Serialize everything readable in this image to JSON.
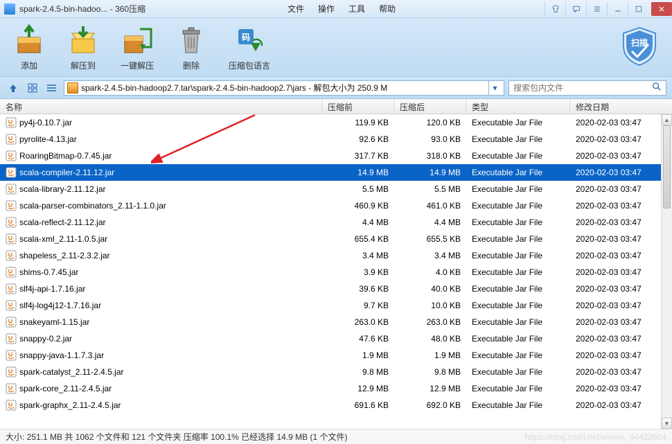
{
  "title": "spark-2.4.5-bin-hadoo... - 360压缩",
  "menu": {
    "file": "文件",
    "operate": "操作",
    "tool": "工具",
    "help": "帮助"
  },
  "ribbon": {
    "add": "添加",
    "extract": "解压到",
    "onekey": "一键解压",
    "delete": "删除",
    "lang": "压缩包语言",
    "scan": "扫描"
  },
  "path": "spark-2.4.5-bin-hadoop2.7.tar\\spark-2.4.5-bin-hadoop2.7\\jars - 解包大小为 250.9 M",
  "search_placeholder": "搜索包内文件",
  "columns": {
    "name": "名称",
    "before": "压缩前",
    "after": "压缩后",
    "type": "类型",
    "date": "修改日期"
  },
  "file_type": "Executable Jar File",
  "file_date": "2020-02-03 03:47",
  "files": [
    {
      "name": "py4j-0.10.7.jar",
      "before": "119.9 KB",
      "after": "120.0 KB",
      "sel": false
    },
    {
      "name": "pyrolite-4.13.jar",
      "before": "92.6 KB",
      "after": "93.0 KB",
      "sel": false
    },
    {
      "name": "RoaringBitmap-0.7.45.jar",
      "before": "317.7 KB",
      "after": "318.0 KB",
      "sel": false
    },
    {
      "name": "scala-compiler-2.11.12.jar",
      "before": "14.9 MB",
      "after": "14.9 MB",
      "sel": true
    },
    {
      "name": "scala-library-2.11.12.jar",
      "before": "5.5 MB",
      "after": "5.5 MB",
      "sel": false
    },
    {
      "name": "scala-parser-combinators_2.11-1.1.0.jar",
      "before": "460.9 KB",
      "after": "461.0 KB",
      "sel": false
    },
    {
      "name": "scala-reflect-2.11.12.jar",
      "before": "4.4 MB",
      "after": "4.4 MB",
      "sel": false
    },
    {
      "name": "scala-xml_2.11-1.0.5.jar",
      "before": "655.4 KB",
      "after": "655.5 KB",
      "sel": false
    },
    {
      "name": "shapeless_2.11-2.3.2.jar",
      "before": "3.4 MB",
      "after": "3.4 MB",
      "sel": false
    },
    {
      "name": "shims-0.7.45.jar",
      "before": "3.9 KB",
      "after": "4.0 KB",
      "sel": false
    },
    {
      "name": "slf4j-api-1.7.16.jar",
      "before": "39.6 KB",
      "after": "40.0 KB",
      "sel": false
    },
    {
      "name": "slf4j-log4j12-1.7.16.jar",
      "before": "9.7 KB",
      "after": "10.0 KB",
      "sel": false
    },
    {
      "name": "snakeyaml-1.15.jar",
      "before": "263.0 KB",
      "after": "263.0 KB",
      "sel": false
    },
    {
      "name": "snappy-0.2.jar",
      "before": "47.6 KB",
      "after": "48.0 KB",
      "sel": false
    },
    {
      "name": "snappy-java-1.1.7.3.jar",
      "before": "1.9 MB",
      "after": "1.9 MB",
      "sel": false
    },
    {
      "name": "spark-catalyst_2.11-2.4.5.jar",
      "before": "9.8 MB",
      "after": "9.8 MB",
      "sel": false
    },
    {
      "name": "spark-core_2.11-2.4.5.jar",
      "before": "12.9 MB",
      "after": "12.9 MB",
      "sel": false
    },
    {
      "name": "spark-graphx_2.11-2.4.5.jar",
      "before": "691.6 KB",
      "after": "692.0 KB",
      "sel": false
    }
  ],
  "status": "大小: 251.1 MB 共 1062 个文件和 121 个文件夹 压缩率 100.1% 已经选择 14.9 MB (1 个文件)",
  "watermark": "https://blog.csdn.net/weixin_44422604"
}
